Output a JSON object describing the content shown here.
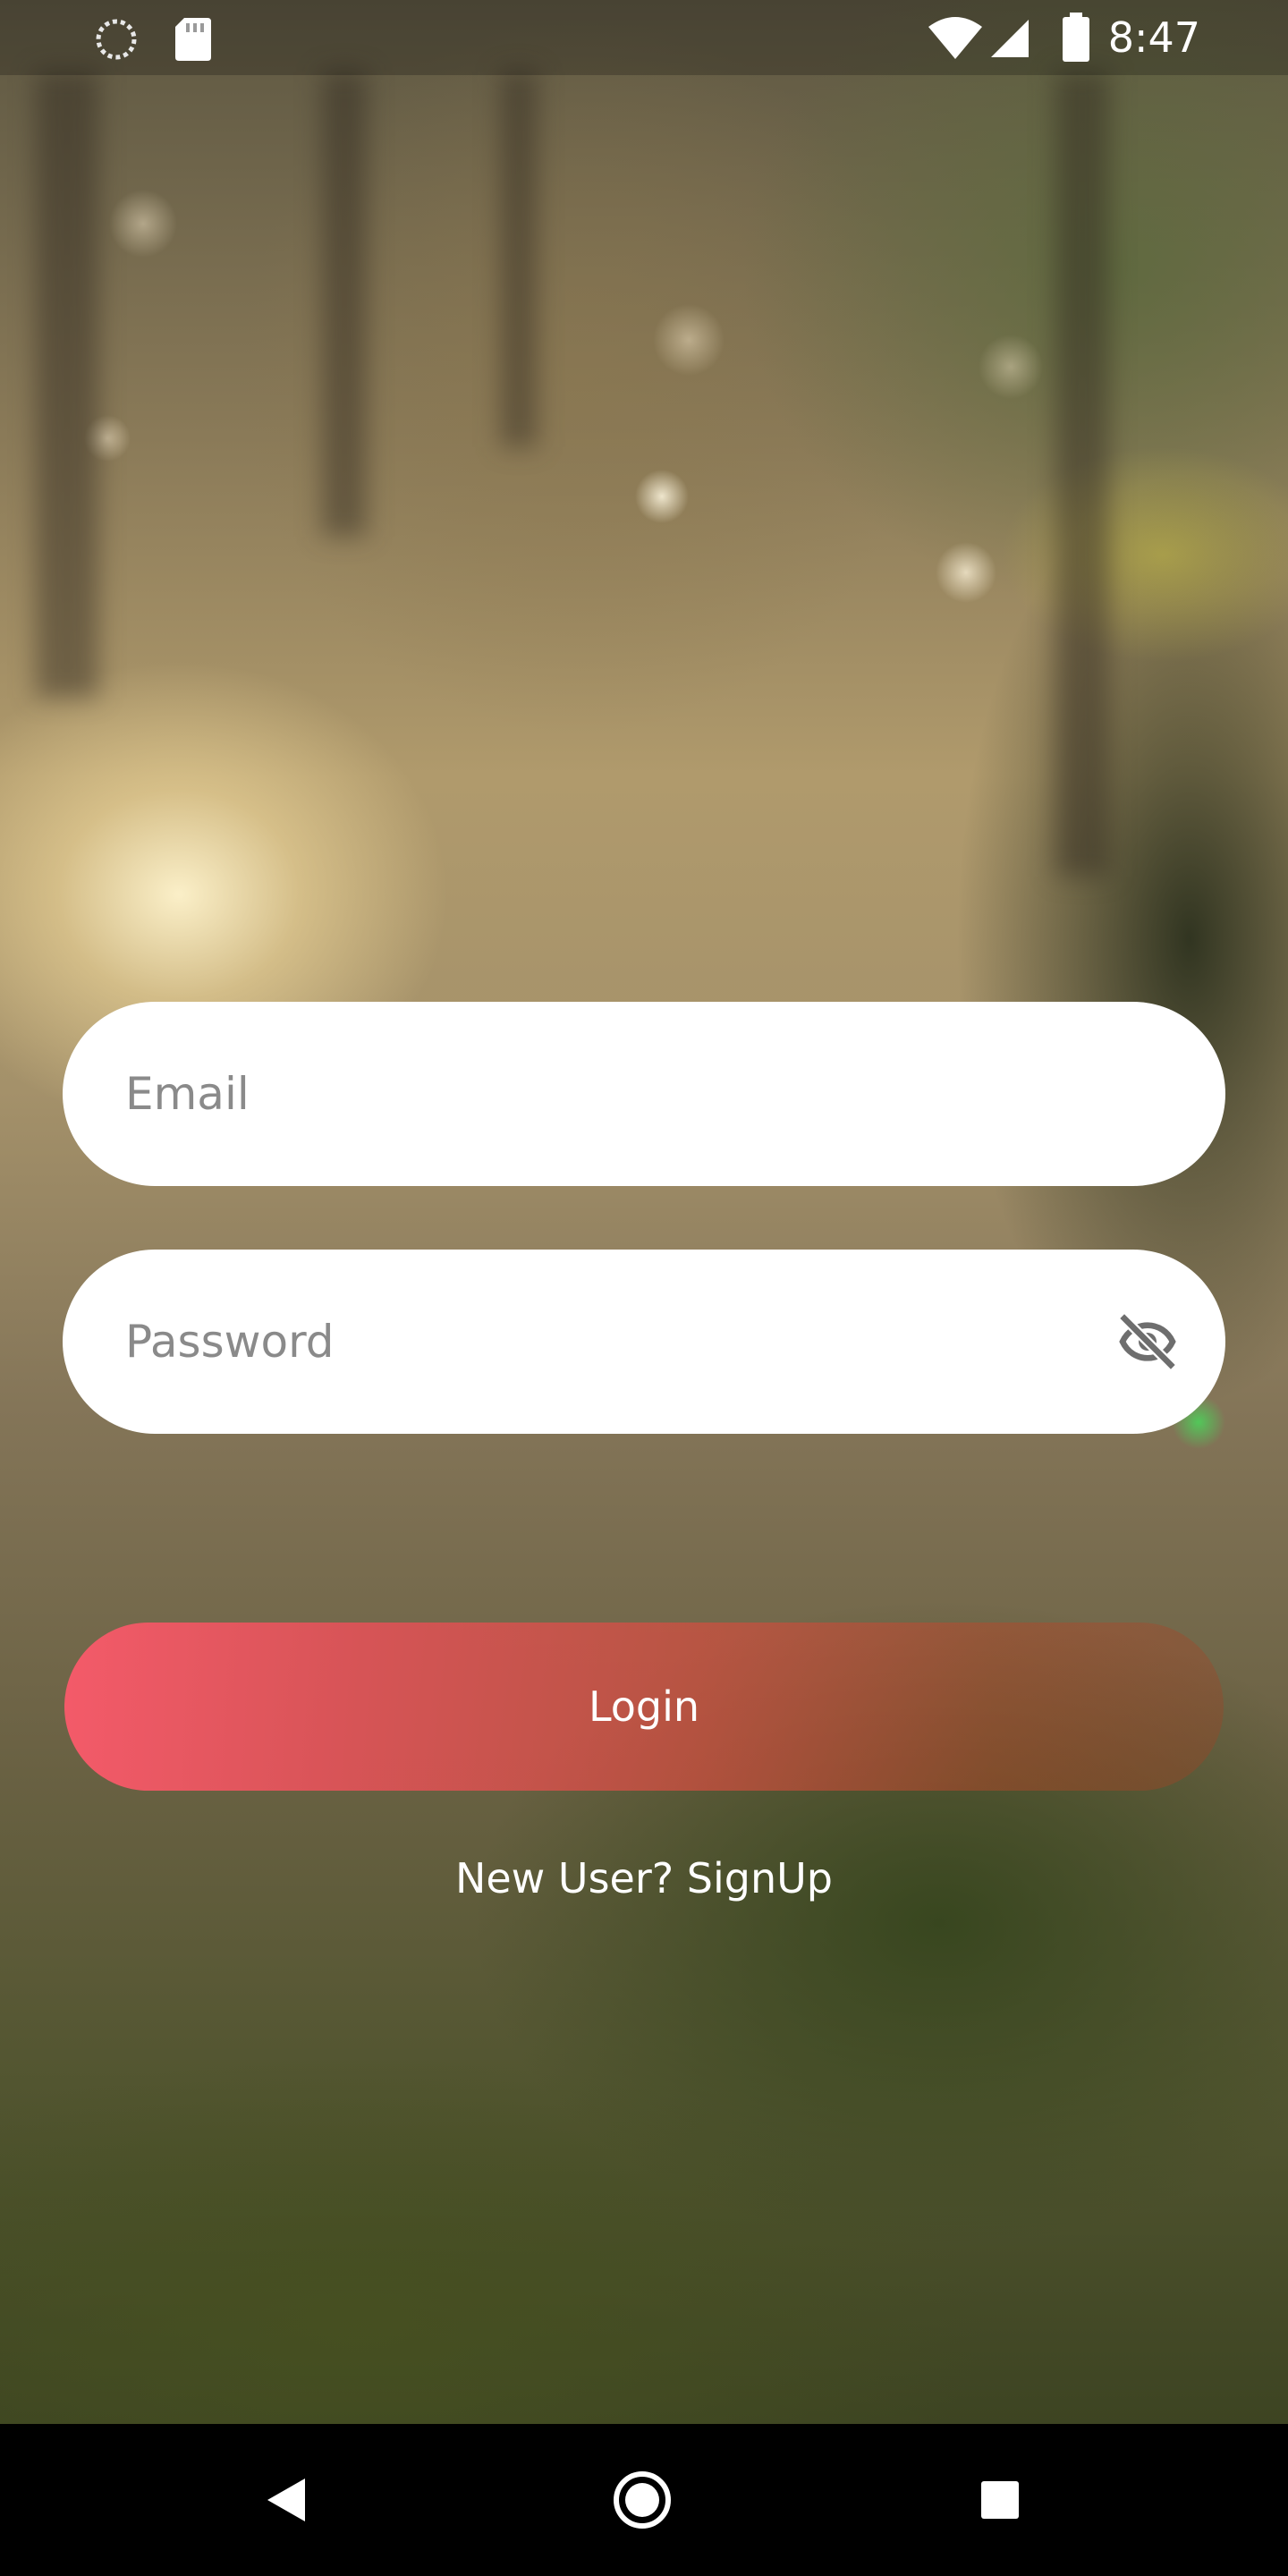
{
  "status_bar": {
    "time": "8:47",
    "icons": [
      "sync-icon",
      "sd-card-icon",
      "wifi-icon",
      "signal-icon",
      "battery-icon"
    ]
  },
  "login_form": {
    "email_placeholder": "Email",
    "password_placeholder": "Password",
    "password_toggle_icon": "visibility-off-icon",
    "login_label": "Login",
    "signup_text": "New User? SignUp"
  },
  "nav_bar": {
    "icons": [
      "back-icon",
      "home-icon",
      "recents-icon"
    ]
  },
  "colors": {
    "login_gradient_start": "#F65A6A",
    "field_background": "#FFFFFF",
    "placeholder_text": "#8A8A8A",
    "toggle_icon": "#6E6E6E"
  }
}
